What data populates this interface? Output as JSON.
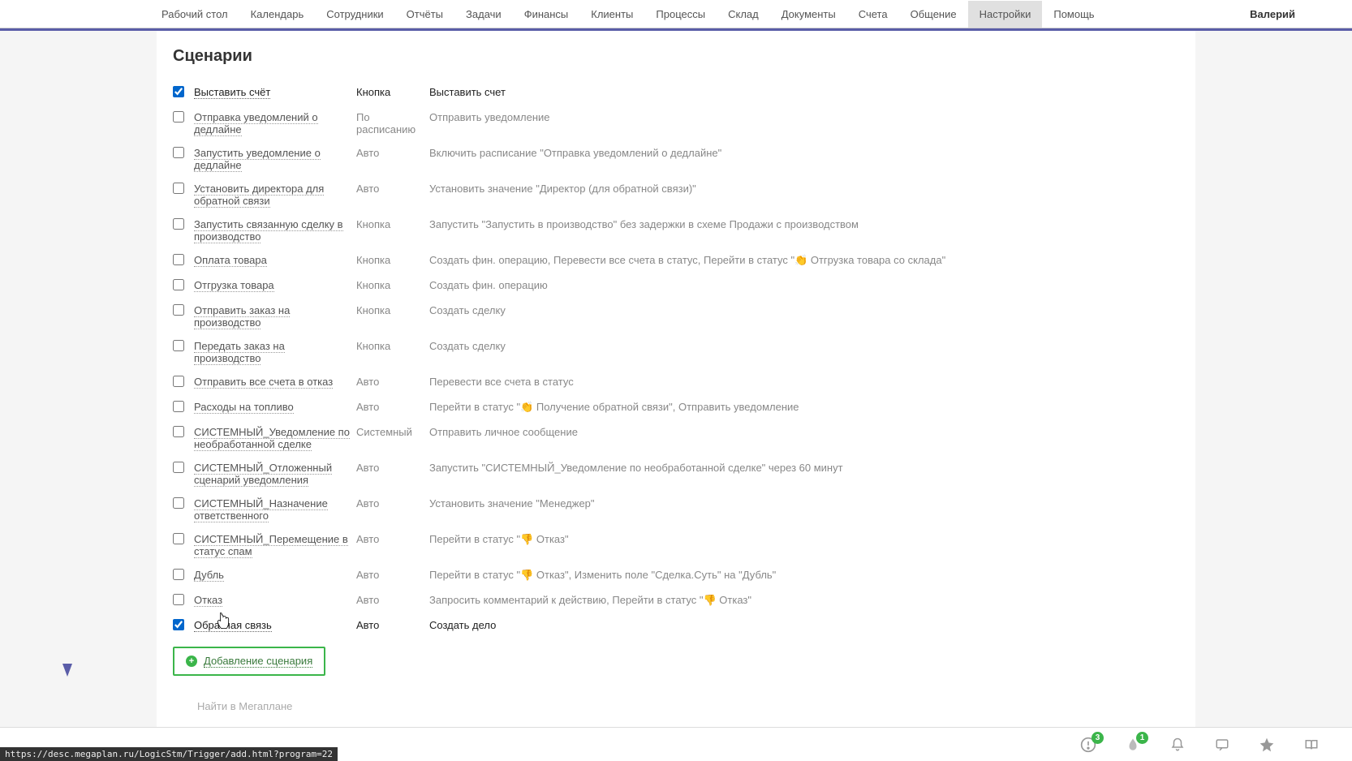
{
  "nav": {
    "items": [
      "Рабочий стол",
      "Календарь",
      "Сотрудники",
      "Отчёты",
      "Задачи",
      "Финансы",
      "Клиенты",
      "Процессы",
      "Склад",
      "Документы",
      "Счета",
      "Общение",
      "Настройки",
      "Помощь"
    ],
    "active_index": 12,
    "user": "Валерий"
  },
  "page": {
    "title": "Сценарии",
    "scenarios": [
      {
        "checked": true,
        "name": "Выставить счёт",
        "type": "Кнопка",
        "desc": "Выставить счет"
      },
      {
        "checked": false,
        "name": "Отправка уведомлений о дедлайне",
        "type": "По расписанию",
        "desc": "Отправить уведомление"
      },
      {
        "checked": false,
        "name": "Запустить уведомление о дедлайне",
        "type": "Авто",
        "desc": "Включить расписание \"Отправка уведомлений о дедлайне\""
      },
      {
        "checked": false,
        "name": "Установить директора для обратной связи",
        "type": "Авто",
        "desc": "Установить значение \"Директор (для обратной связи)\""
      },
      {
        "checked": false,
        "name": "Запустить связанную сделку в производство",
        "type": "Кнопка",
        "desc": "Запустить \"Запустить в производство\" без задержки в схеме Продажи с производством"
      },
      {
        "checked": false,
        "name": "Оплата товара",
        "type": "Кнопка",
        "desc": "Создать фин. операцию, Перевести все счета в статус, Перейти в статус \"👏 Отгрузка товара со склада\""
      },
      {
        "checked": false,
        "name": "Отгрузка товара",
        "type": "Кнопка",
        "desc": "Создать фин. операцию"
      },
      {
        "checked": false,
        "name": "Отправить заказ на производство",
        "type": "Кнопка",
        "desc": "Создать сделку"
      },
      {
        "checked": false,
        "name": "Передать заказ на производство",
        "type": "Кнопка",
        "desc": "Создать сделку"
      },
      {
        "checked": false,
        "name": "Отправить все счета в отказ",
        "type": "Авто",
        "desc": "Перевести все счета в статус"
      },
      {
        "checked": false,
        "name": "Расходы на топливо",
        "type": "Авто",
        "desc": "Перейти в статус \"👏 Получение обратной связи\", Отправить уведомление"
      },
      {
        "checked": false,
        "name": "СИСТЕМНЫЙ_Уведомление по необработанной сделке",
        "type": "Системный",
        "desc": "Отправить личное сообщение"
      },
      {
        "checked": false,
        "name": "СИСТЕМНЫЙ_Отложенный сценарий уведомления",
        "type": "Авто",
        "desc": "Запустить \"СИСТЕМНЫЙ_Уведомление по необработанной сделке\" через 60 минут"
      },
      {
        "checked": false,
        "name": "СИСТЕМНЫЙ_Назначение ответственного",
        "type": "Авто",
        "desc": "Установить значение \"Менеджер\""
      },
      {
        "checked": false,
        "name": "СИСТЕМНЫЙ_Перемещение в статус спам",
        "type": "Авто",
        "desc": "Перейти в статус \"👎 Отказ\""
      },
      {
        "checked": false,
        "name": "Дубль",
        "type": "Авто",
        "desc": "Перейти в статус \"👎 Отказ\", Изменить поле \"Сделка.Суть\" на \"Дубль\""
      },
      {
        "checked": false,
        "name": "Отказ",
        "type": "Авто",
        "desc": "Запросить комментарий к действию, Перейти в статус \"👎 Отказ\""
      },
      {
        "checked": true,
        "name": "Обратная связь",
        "type": "Авто",
        "desc": "Создать дело"
      }
    ],
    "add_button": "Добавление сценария",
    "search_placeholder": "Найти в Мегаплане"
  },
  "bottom": {
    "alerts": "3",
    "fire": "1"
  },
  "status_url": "https://desc.megaplan.ru/LogicStm/Trigger/add.html?program=22"
}
